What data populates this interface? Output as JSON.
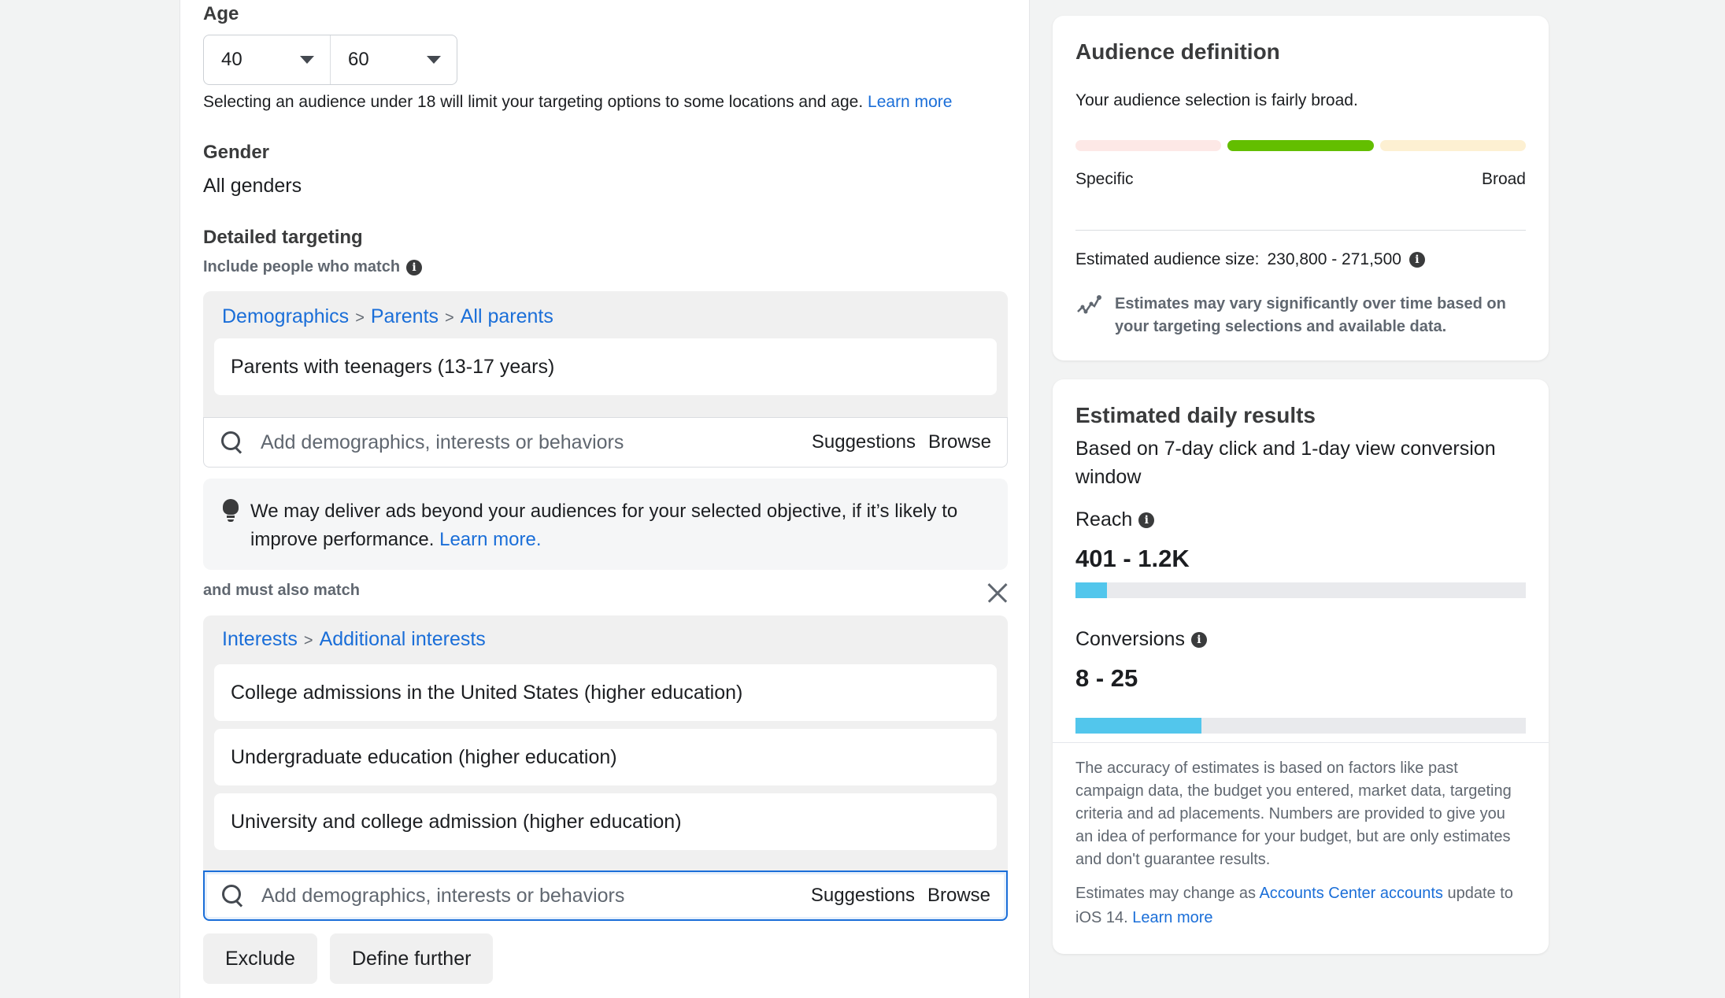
{
  "age": {
    "label": "Age",
    "min": "40",
    "max": "60",
    "note": "Selecting an audience under 18 will limit your targeting options to some locations and age.",
    "learn_more": "Learn more"
  },
  "gender": {
    "label": "Gender",
    "value": "All genders"
  },
  "detailed_targeting": {
    "label": "Detailed targeting",
    "include_label": "Include people who match",
    "group1": {
      "breadcrumb": [
        "Demographics",
        "Parents",
        "All parents"
      ],
      "separator": ">",
      "items": [
        "Parents with teenagers (13-17 years)"
      ]
    },
    "search": {
      "placeholder": "Add demographics, interests or behaviors",
      "suggestions": "Suggestions",
      "browse": "Browse"
    },
    "tip": {
      "text": "We may deliver ads beyond your audiences for your selected objective, if it’s likely to improve performance.",
      "link": "Learn more."
    },
    "must_also_match": "and must also match",
    "group2": {
      "breadcrumb": [
        "Interests",
        "Additional interests"
      ],
      "separator": ">",
      "items": [
        "College admissions in the United States (higher education)",
        "Undergraduate education (higher education)",
        "University and college admission (higher education)"
      ]
    },
    "buttons": {
      "exclude": "Exclude",
      "define_further": "Define further"
    }
  },
  "audience_definition": {
    "title": "Audience definition",
    "description": "Your audience selection is fairly broad.",
    "meter": {
      "active_segment": 2,
      "segments": 3,
      "colors": [
        "#fde8e6",
        "#63be00",
        "#fdf0d2"
      ],
      "left_label": "Specific",
      "right_label": "Broad"
    },
    "size_label": "Estimated audience size:",
    "size_value": "230,800 - 271,500",
    "note": "Estimates may vary significantly over time based on your targeting selections and available data."
  },
  "estimated_daily_results": {
    "title": "Estimated daily results",
    "subtitle": "Based on 7-day click and 1-day view conversion window",
    "reach": {
      "label": "Reach",
      "value": "401 - 1.2K",
      "fill_percent": 7
    },
    "conversions": {
      "label": "Conversions",
      "value": "8 - 25",
      "fill_percent": 28
    },
    "bar_color": "#52c6ec",
    "disclaimer": "The accuracy of estimates is based on factors like past campaign data, the budget you entered, market data, targeting criteria and ad placements. Numbers are provided to give you an idea of performance for your budget, but are only estimates and don't guarantee results.",
    "ios_note_prefix": "Estimates may change as",
    "ios_link": "Accounts Center accounts",
    "ios_note_suffix": "update to iOS 14.",
    "learn_more": "Learn more"
  }
}
